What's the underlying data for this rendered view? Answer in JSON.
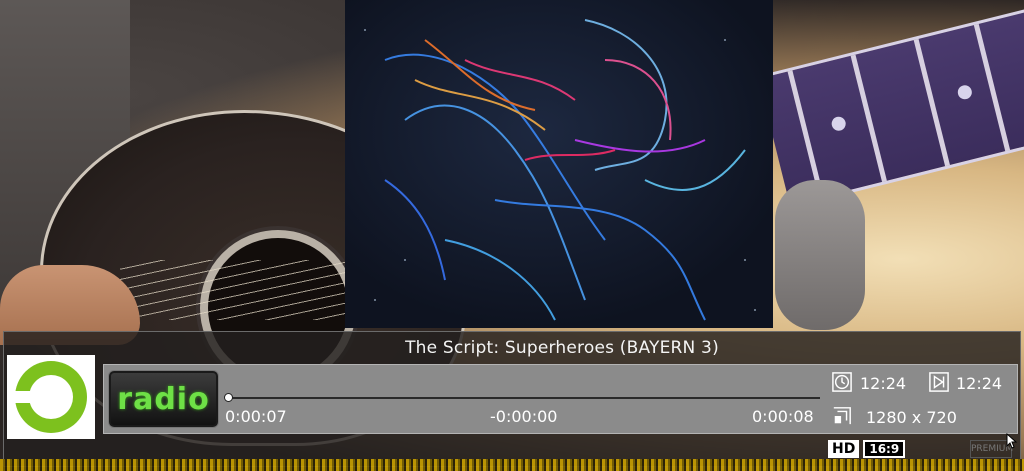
{
  "player": {
    "now_playing": "The Script: Superheroes (BAYERN 3)",
    "station_logo_text": "3",
    "source_badge": "radio",
    "elapsed": "0:00:07",
    "remaining": "-0:00:00",
    "duration": "0:00:08",
    "progress": 0.0,
    "clock_time": "12:24",
    "end_time": "12:24",
    "resolution": "1280 x 720",
    "hd_badge": "HD",
    "aspect_badge": "16:9",
    "premium_label": "PREMIUM"
  },
  "colors": {
    "radio_text": "#6ee046",
    "station_green": "#7dc11e",
    "equalizer": "#c9a000"
  },
  "icons": {
    "clock": "clock-icon",
    "end": "play-end-icon",
    "resolution": "screen-size-icon"
  }
}
